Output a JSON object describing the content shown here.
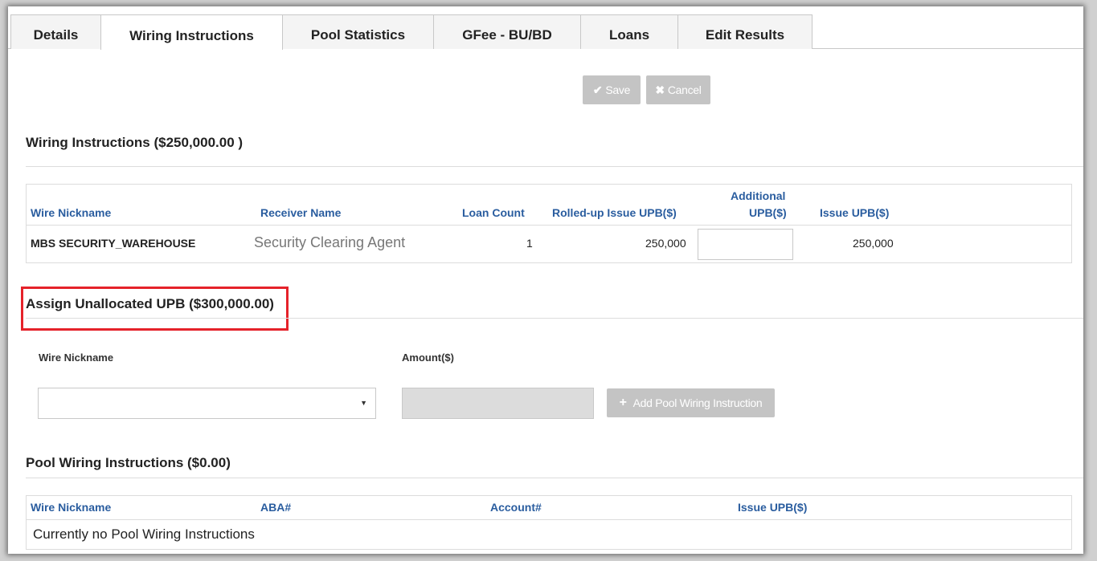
{
  "tabs": [
    {
      "label": "Details",
      "active": false
    },
    {
      "label": "Wiring Instructions",
      "active": true
    },
    {
      "label": "Pool Statistics",
      "active": false
    },
    {
      "label": "GFee - BU/BD",
      "active": false
    },
    {
      "label": "Loans",
      "active": false
    },
    {
      "label": "Edit Results",
      "active": false
    }
  ],
  "toolbar": {
    "save_label": "Save",
    "save_icon": "check-icon",
    "cancel_label": "Cancel",
    "cancel_icon": "close-icon"
  },
  "wiring": {
    "title": "Wiring Instructions ($250,000.00 )",
    "headers": {
      "wire_nickname": "Wire Nickname",
      "receiver_name": "Receiver Name",
      "loan_count": "Loan Count",
      "rolled_up": "Rolled-up Issue UPB($)",
      "additional_line1": "Additional",
      "additional_line2": "UPB($)",
      "issue_upb": "Issue UPB($)"
    },
    "rows": [
      {
        "wire_nickname": "MBS SECURITY_WAREHOUSE",
        "receiver_name": "Security Clearing Agent",
        "loan_count": "1",
        "rolled_up": "250,000",
        "additional": "",
        "issue_upb": "250,000"
      }
    ]
  },
  "assign": {
    "title": "Assign Unallocated UPB ($300,000.00)",
    "wire_nickname_label": "Wire Nickname",
    "amount_label": "Amount($)",
    "wire_nickname_value": "",
    "amount_value": "",
    "add_button_label": "Add Pool Wiring Instruction",
    "add_button_icon": "plus-icon",
    "highlight_color": "#e5222a"
  },
  "pool": {
    "title": "Pool Wiring Instructions ($0.00)",
    "headers": {
      "wire_nickname": "Wire Nickname",
      "aba": "ABA#",
      "account": "Account#",
      "issue_upb": "Issue UPB($)"
    },
    "empty_message": "Currently no Pool Wiring Instructions"
  },
  "colors": {
    "header_blue": "#2a5d9f",
    "disabled_button": "#c4c4c4"
  }
}
